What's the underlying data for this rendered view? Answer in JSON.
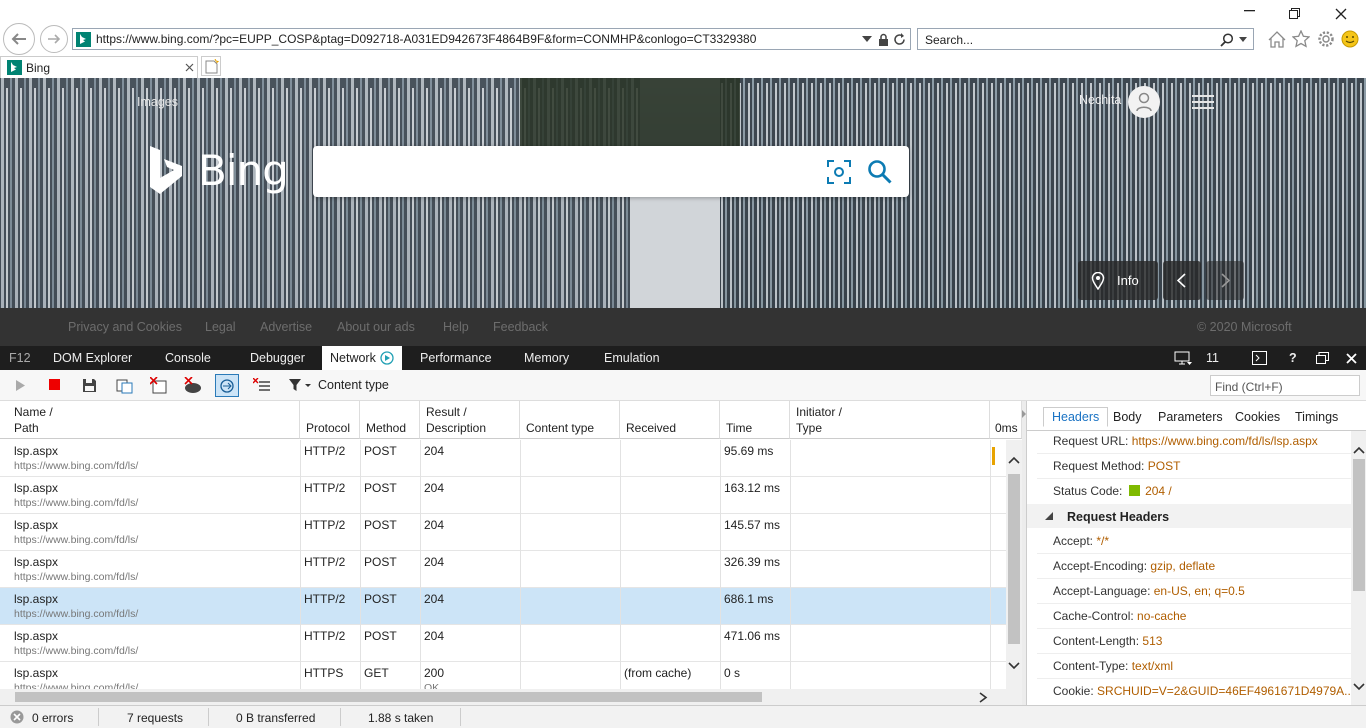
{
  "browser": {
    "address_url": "https://www.bing.com/?pc=EUPP_COSP&ptag=D092718-A031ED942673F4864B9F&form=CONMHP&conlogo=CT3329380",
    "search_placeholder": "Search...",
    "tab_title": "Bing"
  },
  "bing": {
    "images_link": "Images",
    "logo_text": "Bing",
    "user_name": "Nechita",
    "info_label": "Info",
    "footer_links": [
      "Privacy and Cookies",
      "Legal",
      "Advertise",
      "About our ads",
      "Help",
      "Feedback"
    ],
    "copyright": "© 2020 Microsoft"
  },
  "devtools": {
    "tabs": [
      "F12",
      "DOM Explorer",
      "Console",
      "Debugger",
      "Network",
      "Performance",
      "Memory",
      "Emulation"
    ],
    "active_tab": "Network",
    "doc_mode": "11",
    "content_type_filter": "Content type",
    "find_placeholder": "Find (Ctrl+F)",
    "columns": {
      "name": "Name /",
      "path": "Path",
      "protocol": "Protocol",
      "method": "Method",
      "result": "Result /",
      "description": "Description",
      "content_type": "Content type",
      "received": "Received",
      "time": "Time",
      "initiator": "Initiator /",
      "type": "Type",
      "timeline": "0ms"
    },
    "rows": [
      {
        "name": "lsp.aspx",
        "path": "https://www.bing.com/fd/ls/",
        "protocol": "HTTP/2",
        "method": "POST",
        "result": "204",
        "desc": "",
        "received": "",
        "time": "95.69 ms"
      },
      {
        "name": "lsp.aspx",
        "path": "https://www.bing.com/fd/ls/",
        "protocol": "HTTP/2",
        "method": "POST",
        "result": "204",
        "desc": "",
        "received": "",
        "time": "163.12 ms"
      },
      {
        "name": "lsp.aspx",
        "path": "https://www.bing.com/fd/ls/",
        "protocol": "HTTP/2",
        "method": "POST",
        "result": "204",
        "desc": "",
        "received": "",
        "time": "145.57 ms"
      },
      {
        "name": "lsp.aspx",
        "path": "https://www.bing.com/fd/ls/",
        "protocol": "HTTP/2",
        "method": "POST",
        "result": "204",
        "desc": "",
        "received": "",
        "time": "326.39 ms"
      },
      {
        "name": "lsp.aspx",
        "path": "https://www.bing.com/fd/ls/",
        "protocol": "HTTP/2",
        "method": "POST",
        "result": "204",
        "desc": "",
        "received": "",
        "time": "686.1 ms"
      },
      {
        "name": "lsp.aspx",
        "path": "https://www.bing.com/fd/ls/",
        "protocol": "HTTP/2",
        "method": "POST",
        "result": "204",
        "desc": "",
        "received": "",
        "time": "471.06 ms"
      },
      {
        "name": "lsp.aspx",
        "path": "https://www.bing.com/fd/ls/",
        "protocol": "HTTPS",
        "method": "GET",
        "result": "200",
        "desc": "OK",
        "received": "(from cache)",
        "time": "0 s"
      }
    ],
    "selected_row": 4,
    "detail_tabs": [
      "Headers",
      "Body",
      "Parameters",
      "Cookies",
      "Timings"
    ],
    "details": {
      "request_url_k": "Request URL:",
      "request_url_v": "https://www.bing.com/fd/ls/lsp.aspx",
      "request_method_k": "Request Method:",
      "request_method_v": "POST",
      "status_code_k": "Status Code:",
      "status_code_v": "204 /",
      "request_headers": "Request Headers",
      "accept_k": "Accept:",
      "accept_v": "*/*",
      "accept_encoding_k": "Accept-Encoding:",
      "accept_encoding_v": "gzip, deflate",
      "accept_language_k": "Accept-Language:",
      "accept_language_v": "en-US, en; q=0.5",
      "cache_control_k": "Cache-Control:",
      "cache_control_v": "no-cache",
      "content_length_k": "Content-Length:",
      "content_length_v": "513",
      "content_type_k": "Content-Type:",
      "content_type_v": "text/xml",
      "cookie_k": "Cookie:",
      "cookie_v": "SRCHUID=V=2&GUID=46EF4961671D4979A..."
    },
    "status": {
      "errors": "0 errors",
      "requests": "7 requests",
      "transferred": "0 B transferred",
      "taken": "1.88 s taken"
    }
  },
  "colors": {
    "status_green": "#7fba00",
    "value_orange": "#b05e00",
    "selected_row": "#cce4f7",
    "link_blue": "#1a73c4"
  }
}
